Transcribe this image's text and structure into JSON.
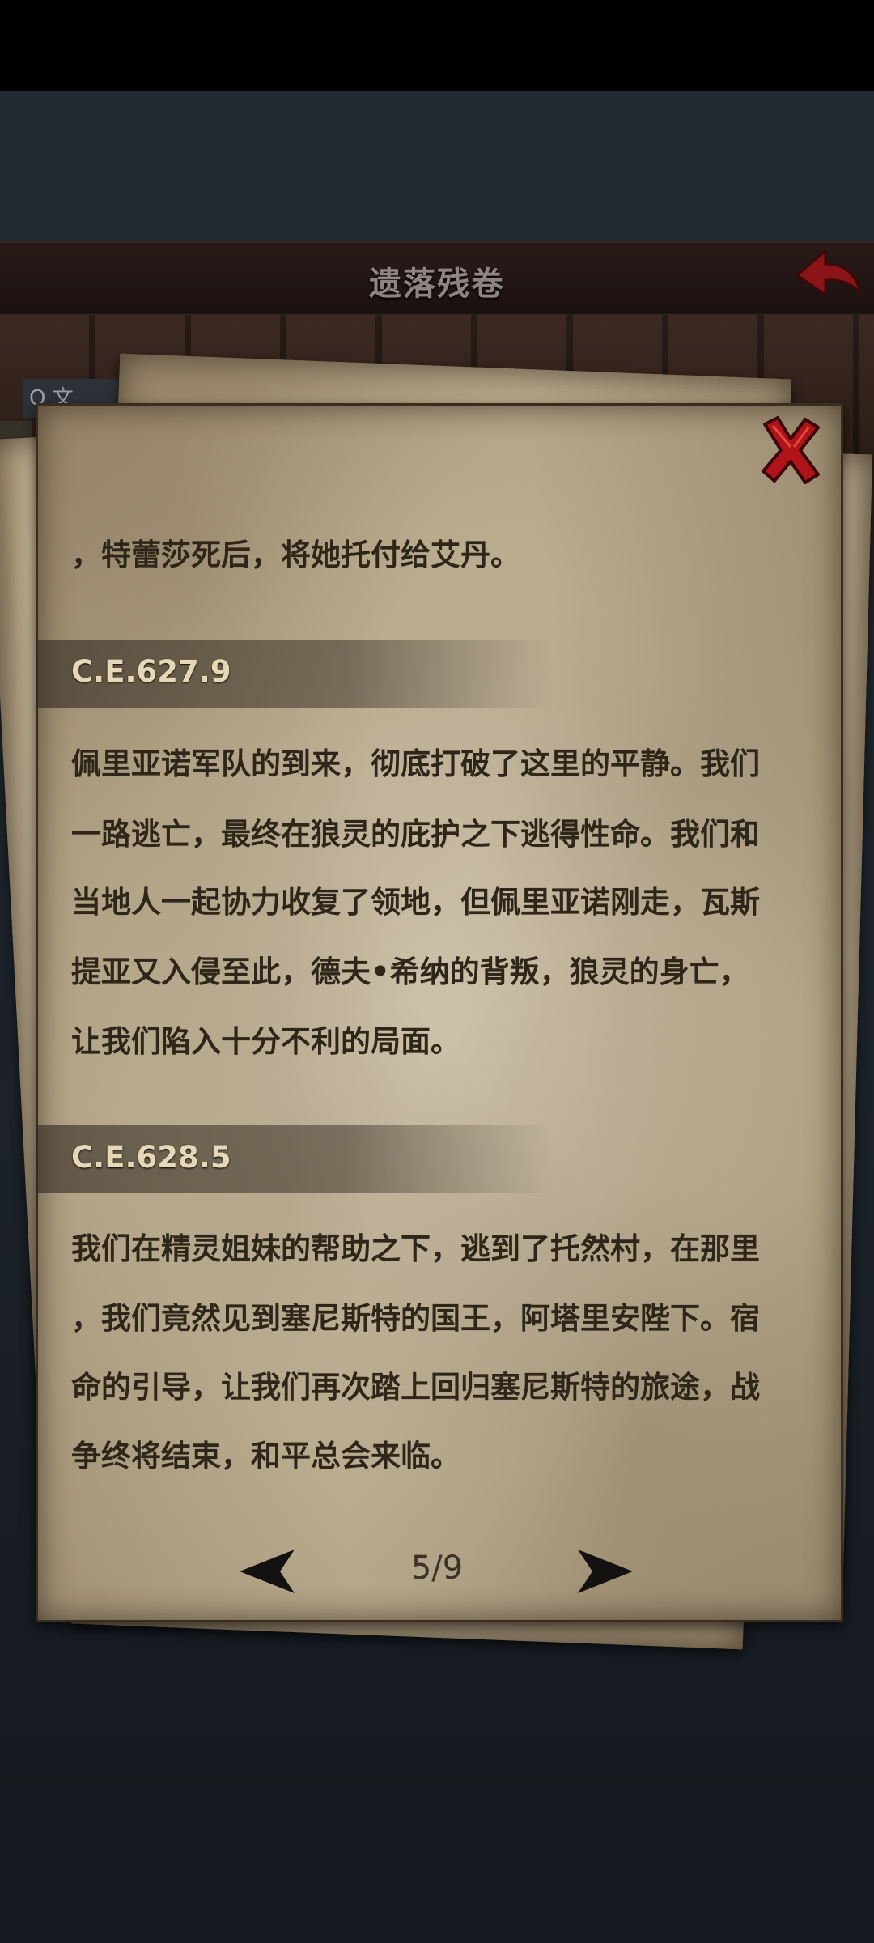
{
  "header": {
    "title": "遗落残卷"
  },
  "search": {
    "text": "Q 文"
  },
  "document": {
    "lines": [
      "，特蕾莎死后，将她托付给艾丹。",
      "佩里亚诺军队的到来，彻底打破了这里的平静。我们",
      "一路逃亡，最终在狼灵的庇护之下逃得性命。我们和",
      "当地人一起协力收复了领地，但佩里亚诺刚走，瓦斯",
      "提亚又入侵至此，德夫•希纳的背叛，狼灵的身亡，",
      "让我们陷入十分不利的局面。",
      "我们在精灵姐妹的帮助之下，逃到了托然村，在那里",
      "，我们竟然见到塞尼斯特的国王，阿塔里安陛下。宿",
      "命的引导，让我们再次踏上回归塞尼斯特的旅途，战",
      "争终将结束，和平总会来临。"
    ],
    "dates": [
      "C.E.627.9",
      "C.E.628.5"
    ]
  },
  "pagination": {
    "current": "5/9"
  },
  "icons": {
    "close": "close-x-icon",
    "back": "back-arrow-icon",
    "prev": "arrow-left-icon",
    "next": "arrow-right-icon"
  },
  "colors": {
    "close_red": "#b0141a",
    "ink": "#2e2619",
    "date_text": "#e6d7b6"
  }
}
